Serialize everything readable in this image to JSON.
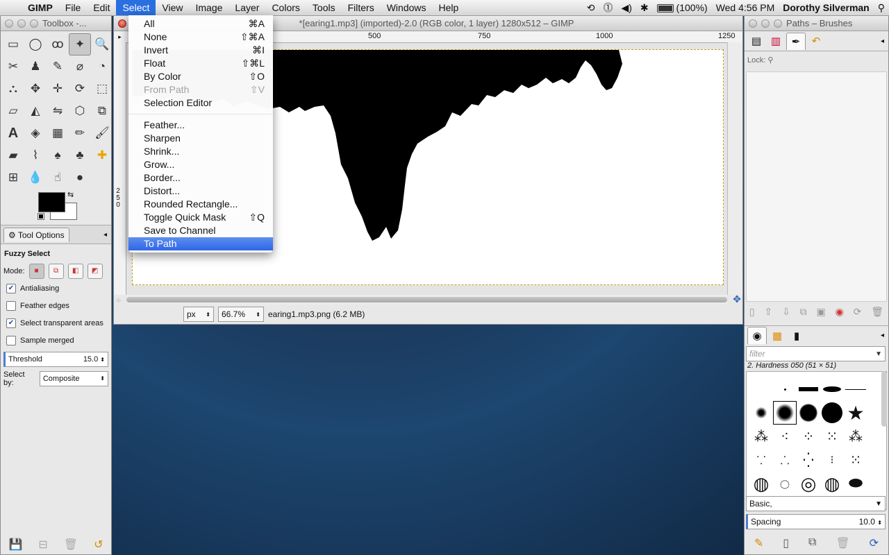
{
  "menubar": {
    "app": "GIMP",
    "items": [
      "File",
      "Edit",
      "Select",
      "View",
      "Image",
      "Layer",
      "Colors",
      "Tools",
      "Filters",
      "Windows",
      "Help"
    ],
    "active_item": "Select",
    "battery": "(100%)",
    "clock": "Wed 4:56 PM",
    "user": "Dorothy Silverman"
  },
  "toolbox": {
    "title": "Toolbox -...",
    "options_tab": "Tool Options",
    "tool_name": "Fuzzy Select",
    "mode_label": "Mode:",
    "antialiasing": "Antialiasing",
    "feather_edges": "Feather edges",
    "select_transparent": "Select transparent areas",
    "sample_merged": "Sample merged",
    "threshold_label": "Threshold",
    "threshold_value": "15.0",
    "select_by_label": "Select by:",
    "select_by_value": "Composite"
  },
  "image_window": {
    "title": "*[earing1.mp3] (imported)-2.0 (RGB color, 1 layer) 1280x512 – GIMP",
    "ruler_h": [
      "500",
      "750",
      "1000",
      "1250"
    ],
    "ruler_v": [
      "2",
      "5",
      "0"
    ],
    "unit": "px",
    "zoom": "66.7%",
    "status": "earing1.mp3.png (6.2 MB)"
  },
  "select_menu": {
    "group1": [
      {
        "label": "All",
        "shortcut": "⌘A",
        "disabled": false
      },
      {
        "label": "None",
        "shortcut": "⇧⌘A",
        "disabled": false
      },
      {
        "label": "Invert",
        "shortcut": "⌘I",
        "disabled": false
      },
      {
        "label": "Float",
        "shortcut": "⇧⌘L",
        "disabled": false
      },
      {
        "label": "By Color",
        "shortcut": "⇧O",
        "disabled": false
      },
      {
        "label": "From Path",
        "shortcut": "⇧V",
        "disabled": true
      },
      {
        "label": "Selection Editor",
        "shortcut": "",
        "disabled": false
      }
    ],
    "group2": [
      {
        "label": "Feather...",
        "shortcut": ""
      },
      {
        "label": "Sharpen",
        "shortcut": ""
      },
      {
        "label": "Shrink...",
        "shortcut": ""
      },
      {
        "label": "Grow...",
        "shortcut": ""
      },
      {
        "label": "Border...",
        "shortcut": ""
      },
      {
        "label": "Distort...",
        "shortcut": ""
      },
      {
        "label": "Rounded Rectangle...",
        "shortcut": ""
      },
      {
        "label": "Toggle Quick Mask",
        "shortcut": "⇧Q"
      },
      {
        "label": "Save to Channel",
        "shortcut": ""
      },
      {
        "label": "To Path",
        "shortcut": "",
        "highlighted": true
      }
    ]
  },
  "right_dock": {
    "title": "Paths – Brushes",
    "lock_label": "Lock:",
    "filter_placeholder": "filter",
    "brush_name": "2. Hardness 050 (51 × 51)",
    "preset": "Basic,",
    "spacing_label": "Spacing",
    "spacing_value": "10.0"
  }
}
